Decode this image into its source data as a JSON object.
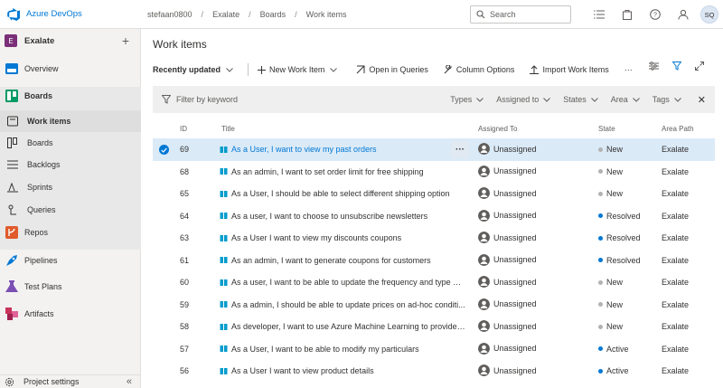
{
  "app": {
    "brand": "Azure DevOps"
  },
  "breadcrumb": [
    "stefaan0800",
    "Exalate",
    "Boards",
    "Work items"
  ],
  "search": {
    "placeholder": "Search"
  },
  "user": {
    "initials": "SQ"
  },
  "project": {
    "name": "Exalate",
    "badge": "E"
  },
  "sidebar": {
    "items": [
      {
        "label": "Overview",
        "icon": "overview-icon",
        "color": "#0078d4"
      },
      {
        "label": "Boards",
        "icon": "boards-icon",
        "color": "#009a66"
      },
      {
        "label": "Work items",
        "icon": "work-items-icon",
        "sub": true
      },
      {
        "label": "Boards",
        "icon": "board-icon",
        "sub": true
      },
      {
        "label": "Backlogs",
        "icon": "backlogs-icon",
        "sub": true
      },
      {
        "label": "Sprints",
        "icon": "sprints-icon",
        "sub": true
      },
      {
        "label": "Queries",
        "icon": "queries-icon",
        "sub": true
      },
      {
        "label": "Repos",
        "icon": "repos-icon",
        "color": "#e05a2b"
      },
      {
        "label": "Pipelines",
        "icon": "pipelines-icon",
        "color": "#0078d4"
      },
      {
        "label": "Test Plans",
        "icon": "test-plans-icon",
        "color": "#7b4fb3"
      },
      {
        "label": "Artifacts",
        "icon": "artifacts-icon",
        "color": "#c8345a"
      }
    ],
    "footer": "Project settings"
  },
  "page": {
    "title": "Work items"
  },
  "toolbar": {
    "view": "Recently updated",
    "new_item": "New Work Item",
    "open_queries": "Open in Queries",
    "column_options": "Column Options",
    "import": "Import Work Items",
    "more": "···"
  },
  "filter": {
    "placeholder": "Filter by keyword",
    "pills": [
      "Types",
      "Assigned to",
      "States",
      "Area",
      "Tags"
    ]
  },
  "table": {
    "headers": {
      "id": "ID",
      "title": "Title",
      "assigned": "Assigned To",
      "state": "State",
      "area": "Area Path"
    },
    "rows": [
      {
        "id": "69",
        "title": "As a User, I want to view my past orders",
        "assigned": "Unassigned",
        "state": "New",
        "area": "Exalate"
      },
      {
        "id": "68",
        "title": "As an admin, I want to set order limit for free shipping",
        "assigned": "Unassigned",
        "state": "New",
        "area": "Exalate"
      },
      {
        "id": "65",
        "title": "As a User, I should be able to select different shipping option",
        "assigned": "Unassigned",
        "state": "New",
        "area": "Exalate"
      },
      {
        "id": "64",
        "title": "As a user, I want to choose to unsubscribe newsletters",
        "assigned": "Unassigned",
        "state": "Resolved",
        "area": "Exalate"
      },
      {
        "id": "63",
        "title": "As a User I want to view my discounts coupons",
        "assigned": "Unassigned",
        "state": "Resolved",
        "area": "Exalate"
      },
      {
        "id": "61",
        "title": "As an admin, I want to generate coupons for customers",
        "assigned": "Unassigned",
        "state": "Resolved",
        "area": "Exalate"
      },
      {
        "id": "60",
        "title": "As a user, I want to be able to update the frequency and type of...",
        "assigned": "Unassigned",
        "state": "New",
        "area": "Exalate"
      },
      {
        "id": "59",
        "title": "As a admin, I should be able to update prices on ad-hoc conditi...",
        "assigned": "Unassigned",
        "state": "New",
        "area": "Exalate"
      },
      {
        "id": "58",
        "title": "As developer, I want to use Azure Machine Learning to provide ...",
        "assigned": "Unassigned",
        "state": "New",
        "area": "Exalate"
      },
      {
        "id": "57",
        "title": "As a User, I want to be able to modify my particulars",
        "assigned": "Unassigned",
        "state": "Active",
        "area": "Exalate"
      },
      {
        "id": "56",
        "title": "As a User I want to view product details",
        "assigned": "Unassigned",
        "state": "Active",
        "area": "Exalate"
      }
    ]
  },
  "state_colors": {
    "New": "#b2b2b2",
    "Resolved": "#0078d4",
    "Active": "#0078d4"
  }
}
